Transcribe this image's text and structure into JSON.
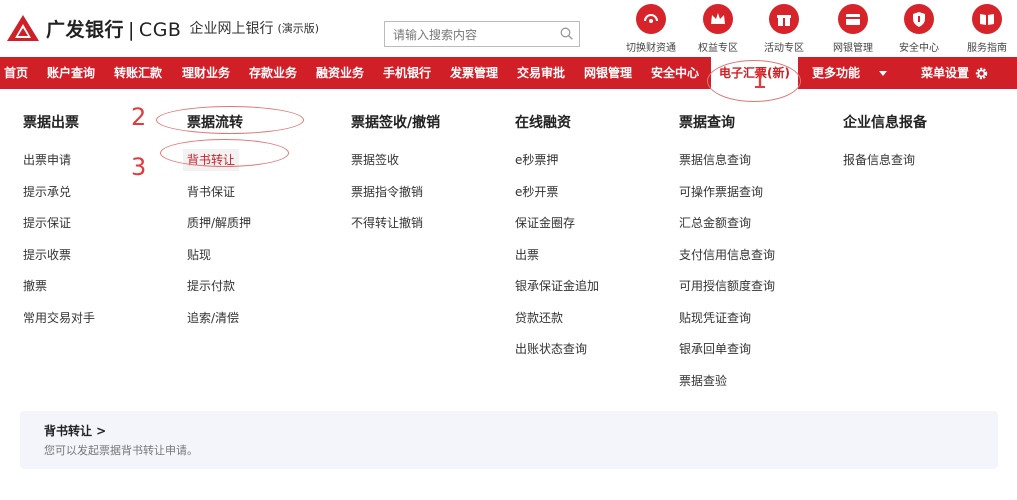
{
  "brand": {
    "bank_name": "广发银行",
    "separator": "|",
    "code": "CGB",
    "subtitle": "企业网上银行",
    "demo": "(演示版)"
  },
  "search": {
    "placeholder": "请输入搜索内容"
  },
  "quick_links": [
    {
      "label": "切换财资通",
      "icon": "switch-icon"
    },
    {
      "label": "权益专区",
      "icon": "crown-icon"
    },
    {
      "label": "活动专区",
      "icon": "gift-icon"
    },
    {
      "label": "网银管理",
      "icon": "card-icon"
    },
    {
      "label": "安全中心",
      "icon": "shield-icon"
    },
    {
      "label": "服务指南",
      "icon": "book-icon"
    }
  ],
  "nav": {
    "items": [
      "首页",
      "账户查询",
      "转账汇款",
      "理财业务",
      "存款业务",
      "融资业务",
      "手机银行",
      "发票管理",
      "交易审批",
      "网银管理",
      "安全中心",
      "电子汇票(新)",
      "更多功能",
      "菜单设置"
    ],
    "active_index": 11
  },
  "menu": {
    "columns": [
      {
        "title": "票据出票",
        "items": [
          "出票申请",
          "提示承兑",
          "提示保证",
          "提示收票",
          "撤票",
          "常用交易对手"
        ]
      },
      {
        "title": "票据流转",
        "items": [
          "背书转让",
          "背书保证",
          "质押/解质押",
          "贴现",
          "提示付款",
          "追索/清偿"
        ]
      },
      {
        "title": "票据签收/撤销",
        "items": [
          "票据签收",
          "票据指令撤销",
          "不得转让撤销"
        ]
      },
      {
        "title": "在线融资",
        "items": [
          "e秒票押",
          "e秒开票",
          "保证金圈存",
          "出票",
          "银承保证金追加",
          "贷款还款",
          "出账状态查询"
        ]
      },
      {
        "title": "票据查询",
        "items": [
          "票据信息查询",
          "可操作票据查询",
          "汇总金额查询",
          "支付信用信息查询",
          "可用授信额度查询",
          "贴现凭证查询",
          "银承回单查询",
          "票据查验"
        ]
      },
      {
        "title": "企业信息报备",
        "items": [
          "报备信息查询"
        ]
      }
    ],
    "selected": {
      "column": 1,
      "item": 0
    }
  },
  "info": {
    "title": "背书转让 >",
    "description": "您可以发起票据背书转让申请。"
  },
  "annotations": [
    "1",
    "2",
    "3"
  ],
  "colors": {
    "brand_red": "#d01f27",
    "annotation_red": "#e23b3b"
  }
}
